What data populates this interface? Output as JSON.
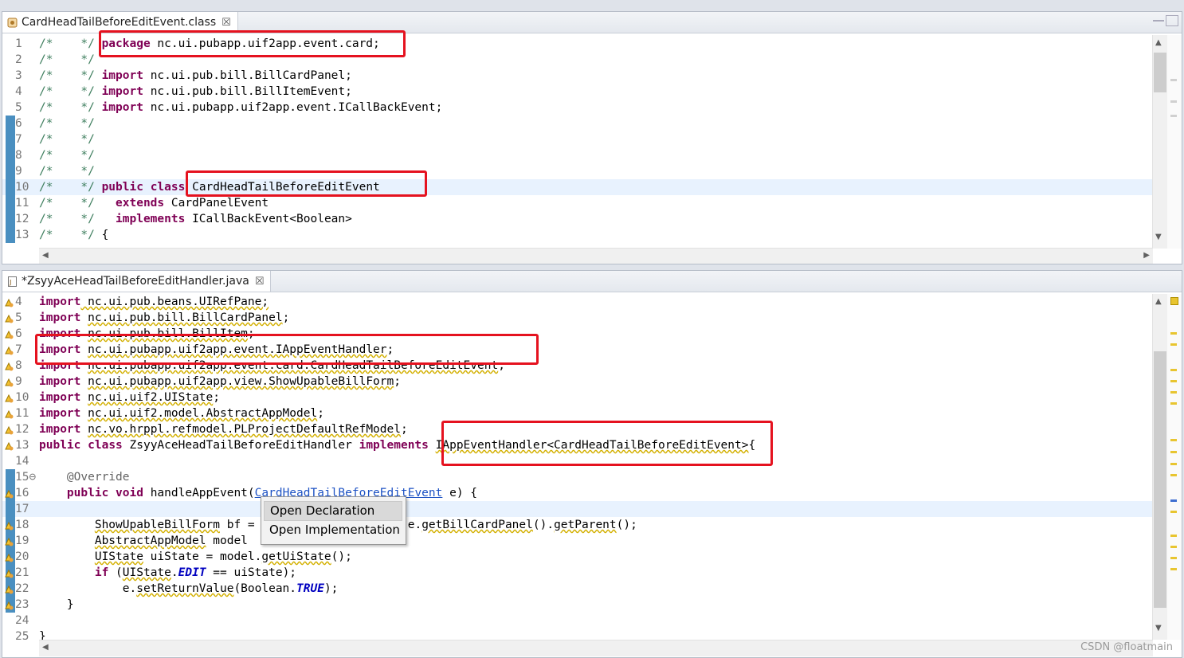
{
  "top_editor": {
    "tab_title": "CardHeadTailBeforeEditEvent.class",
    "tab_close": "☒",
    "lines": [
      {
        "n": "1",
        "segs": [
          {
            "t": "/*    */ ",
            "c": "cm"
          },
          {
            "t": "package",
            "c": "kw"
          },
          {
            "t": " nc.ui.pubapp.uif2app.event.card;",
            "c": ""
          }
        ]
      },
      {
        "n": "2",
        "segs": [
          {
            "t": "/*    */",
            "c": "cm"
          }
        ]
      },
      {
        "n": "3",
        "segs": [
          {
            "t": "/*    */ ",
            "c": "cm"
          },
          {
            "t": "import",
            "c": "kw"
          },
          {
            "t": " nc.ui.pub.bill.BillCardPanel;",
            "c": ""
          }
        ]
      },
      {
        "n": "4",
        "segs": [
          {
            "t": "/*    */ ",
            "c": "cm"
          },
          {
            "t": "import",
            "c": "kw"
          },
          {
            "t": " nc.ui.pub.bill.BillItemEvent;",
            "c": ""
          }
        ]
      },
      {
        "n": "5",
        "segs": [
          {
            "t": "/*    */ ",
            "c": "cm"
          },
          {
            "t": "import",
            "c": "kw"
          },
          {
            "t": " nc.ui.pubapp.uif2app.event.ICallBackEvent;",
            "c": ""
          }
        ]
      },
      {
        "n": "6",
        "segs": [
          {
            "t": "/*    */",
            "c": "cm"
          }
        ],
        "bar": true
      },
      {
        "n": "7",
        "segs": [
          {
            "t": "/*    */",
            "c": "cm"
          }
        ],
        "bar": true
      },
      {
        "n": "8",
        "segs": [
          {
            "t": "/*    */",
            "c": "cm"
          }
        ],
        "bar": true
      },
      {
        "n": "9",
        "segs": [
          {
            "t": "/*    */",
            "c": "cm"
          }
        ],
        "bar": true
      },
      {
        "n": "10",
        "segs": [
          {
            "t": "/*    */ ",
            "c": "cm"
          },
          {
            "t": "public",
            "c": "kw"
          },
          {
            "t": " ",
            "c": ""
          },
          {
            "t": "class",
            "c": "kw"
          },
          {
            "t": " CardHeadTailBeforeEditEvent",
            "c": ""
          }
        ],
        "bar": true,
        "hl": true
      },
      {
        "n": "11",
        "segs": [
          {
            "t": "/*    */   ",
            "c": "cm"
          },
          {
            "t": "extends",
            "c": "kw"
          },
          {
            "t": " CardPanelEvent",
            "c": ""
          }
        ],
        "bar": true
      },
      {
        "n": "12",
        "segs": [
          {
            "t": "/*    */   ",
            "c": "cm"
          },
          {
            "t": "implements",
            "c": "kw"
          },
          {
            "t": " ICallBackEvent<Boolean>",
            "c": ""
          }
        ],
        "bar": true
      },
      {
        "n": "13",
        "segs": [
          {
            "t": "/*    */ ",
            "c": "cm"
          },
          {
            "t": "{",
            "c": ""
          }
        ],
        "bar": true
      }
    ]
  },
  "bottom_editor": {
    "tab_title": "*ZsyyAceHeadTailBeforeEditHandler.java",
    "tab_close": "☒",
    "lines": [
      {
        "n": "4",
        "w": true,
        "segs": [
          {
            "t": "import",
            "c": "kw"
          },
          {
            "t": " nc.ui.pub.beans.UIRefPane;",
            "c": "sq"
          }
        ]
      },
      {
        "n": "5",
        "w": true,
        "segs": [
          {
            "t": "import",
            "c": "kw"
          },
          {
            "t": " ",
            "c": ""
          },
          {
            "t": "nc.ui.pub.bill.BillCardPanel",
            "c": "sq"
          },
          {
            "t": ";",
            "c": ""
          }
        ]
      },
      {
        "n": "6",
        "w": true,
        "segs": [
          {
            "t": "import",
            "c": "kw"
          },
          {
            "t": " ",
            "c": ""
          },
          {
            "t": "nc.ui.pub.bill.BillItem",
            "c": "sq"
          },
          {
            "t": ";",
            "c": ""
          }
        ]
      },
      {
        "n": "7",
        "w": true,
        "segs": [
          {
            "t": "import",
            "c": "kw"
          },
          {
            "t": " ",
            "c": ""
          },
          {
            "t": "nc.ui.pubapp.uif2app.event.IAppEventHandler",
            "c": "sq"
          },
          {
            "t": ";",
            "c": ""
          }
        ]
      },
      {
        "n": "8",
        "w": true,
        "segs": [
          {
            "t": "import",
            "c": "kw"
          },
          {
            "t": " ",
            "c": ""
          },
          {
            "t": "nc.ui.pubapp.uif2app.event.card.CardHeadTailBeforeEditEvent",
            "c": "sq"
          },
          {
            "t": ";",
            "c": ""
          }
        ]
      },
      {
        "n": "9",
        "w": true,
        "segs": [
          {
            "t": "import",
            "c": "kw"
          },
          {
            "t": " ",
            "c": ""
          },
          {
            "t": "nc.ui.pubapp.uif2app.view.ShowUpableBillForm",
            "c": "sq"
          },
          {
            "t": ";",
            "c": ""
          }
        ]
      },
      {
        "n": "10",
        "w": true,
        "segs": [
          {
            "t": "import",
            "c": "kw"
          },
          {
            "t": " ",
            "c": ""
          },
          {
            "t": "nc.ui.uif2.UIState",
            "c": "sq"
          },
          {
            "t": ";",
            "c": ""
          }
        ]
      },
      {
        "n": "11",
        "w": true,
        "segs": [
          {
            "t": "import",
            "c": "kw"
          },
          {
            "t": " ",
            "c": ""
          },
          {
            "t": "nc.ui.uif2.model.AbstractAppModel",
            "c": "sq"
          },
          {
            "t": ";",
            "c": ""
          }
        ]
      },
      {
        "n": "12",
        "w": true,
        "segs": [
          {
            "t": "import",
            "c": "kw"
          },
          {
            "t": " ",
            "c": ""
          },
          {
            "t": "nc.vo.hrppl.refmodel.PLProjectDefaultRefModel",
            "c": "sq"
          },
          {
            "t": ";",
            "c": ""
          }
        ]
      },
      {
        "n": "13",
        "w": true,
        "segs": [
          {
            "t": "public",
            "c": "kw"
          },
          {
            "t": " ",
            "c": ""
          },
          {
            "t": "class",
            "c": "kw"
          },
          {
            "t": " ZsyyAceHeadTailBeforeEditHandler ",
            "c": ""
          },
          {
            "t": "implements",
            "c": "kw"
          },
          {
            "t": " ",
            "c": ""
          },
          {
            "t": "IAppEventHandler<CardHeadTailBeforeEditEvent>",
            "c": "sq"
          },
          {
            "t": "{",
            "c": ""
          }
        ]
      },
      {
        "n": "14",
        "segs": []
      },
      {
        "n": "15⊖",
        "bar": true,
        "segs": [
          {
            "t": "    @Override",
            "c": "ann"
          }
        ]
      },
      {
        "n": "16",
        "w": true,
        "bar": true,
        "segs": [
          {
            "t": "    ",
            "c": ""
          },
          {
            "t": "public",
            "c": "kw"
          },
          {
            "t": " ",
            "c": ""
          },
          {
            "t": "void",
            "c": "kw"
          },
          {
            "t": " handleAppEvent(",
            "c": ""
          },
          {
            "t": "CardHeadTailBeforeEditEvent",
            "c": "lnk"
          },
          {
            "t": " e) {",
            "c": ""
          }
        ]
      },
      {
        "n": "17",
        "bar": true,
        "hl": true,
        "segs": []
      },
      {
        "n": "18",
        "w": true,
        "bar": true,
        "segs": [
          {
            "t": "        ",
            "c": ""
          },
          {
            "t": "ShowUpableBillForm",
            "c": "sq"
          },
          {
            "t": " bf = ",
            "c": ""
          },
          {
            "t": "                    ",
            "c": ""
          },
          {
            "t": ")e.",
            "c": ""
          },
          {
            "t": "getBillCardPanel",
            "c": "sq"
          },
          {
            "t": "().",
            "c": ""
          },
          {
            "t": "getParent",
            "c": "sq"
          },
          {
            "t": "();",
            "c": ""
          }
        ]
      },
      {
        "n": "19",
        "w": true,
        "bar": true,
        "segs": [
          {
            "t": "        ",
            "c": ""
          },
          {
            "t": "AbstractAppModel",
            "c": "sq"
          },
          {
            "t": " model",
            "c": ""
          }
        ]
      },
      {
        "n": "20",
        "w": true,
        "bar": true,
        "segs": [
          {
            "t": "        ",
            "c": ""
          },
          {
            "t": "UIState",
            "c": "sq"
          },
          {
            "t": " uiState = model.",
            "c": ""
          },
          {
            "t": "getUiState",
            "c": "sq"
          },
          {
            "t": "();",
            "c": ""
          }
        ]
      },
      {
        "n": "21",
        "w": true,
        "bar": true,
        "segs": [
          {
            "t": "        ",
            "c": ""
          },
          {
            "t": "if",
            "c": "kw"
          },
          {
            "t": " (",
            "c": ""
          },
          {
            "t": "UIState",
            "c": "sq"
          },
          {
            "t": ".",
            "c": ""
          },
          {
            "t": "EDIT",
            "c": "sf"
          },
          {
            "t": " == uiState);",
            "c": ""
          }
        ]
      },
      {
        "n": "22",
        "w": true,
        "bar": true,
        "segs": [
          {
            "t": "            e.",
            "c": ""
          },
          {
            "t": "setReturnValue",
            "c": "sq"
          },
          {
            "t": "(Boolean.",
            "c": ""
          },
          {
            "t": "TRUE",
            "c": "sf"
          },
          {
            "t": ");",
            "c": ""
          }
        ]
      },
      {
        "n": "23",
        "w": true,
        "bar": true,
        "segs": [
          {
            "t": "    }",
            "c": ""
          }
        ]
      },
      {
        "n": "24",
        "segs": []
      },
      {
        "n": "25",
        "segs": [
          {
            "t": "}",
            "c": ""
          }
        ]
      }
    ]
  },
  "context_menu": {
    "items": [
      "Open Declaration",
      "Open Implementation"
    ]
  },
  "watermark": "CSDN @floatmain"
}
